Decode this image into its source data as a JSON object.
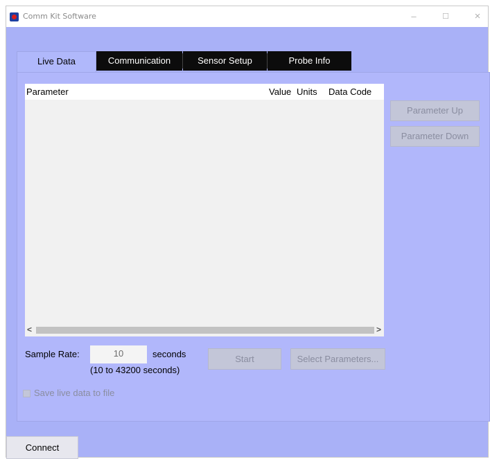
{
  "window": {
    "title": "Comm Kit Software",
    "minimize": "–",
    "maximize": "☐",
    "close": "×"
  },
  "tabs": [
    {
      "label": "Live Data",
      "active": true
    },
    {
      "label": "Communication",
      "active": false
    },
    {
      "label": "Sensor Setup",
      "active": false
    },
    {
      "label": "Probe Info",
      "active": false
    }
  ],
  "table": {
    "columns": [
      "Parameter",
      "Value",
      "Units",
      "Data Code"
    ],
    "rows": [],
    "scroll_left": "<",
    "scroll_right": ">"
  },
  "side_buttons": {
    "up": "Parameter Up",
    "down": "Parameter Down"
  },
  "sample": {
    "label": "Sample Rate:",
    "value": "10",
    "units": "seconds",
    "range": "(10 to 43200 seconds)"
  },
  "actions": {
    "start": "Start",
    "select_parameters": "Select Parameters..."
  },
  "save_to_file": {
    "label": "Save live data to file",
    "checked": false
  },
  "connect": "Connect",
  "colors": {
    "background": "#a9b1f7",
    "panel": "#b1b7fb",
    "tab_inactive": "#0c0c0c"
  }
}
